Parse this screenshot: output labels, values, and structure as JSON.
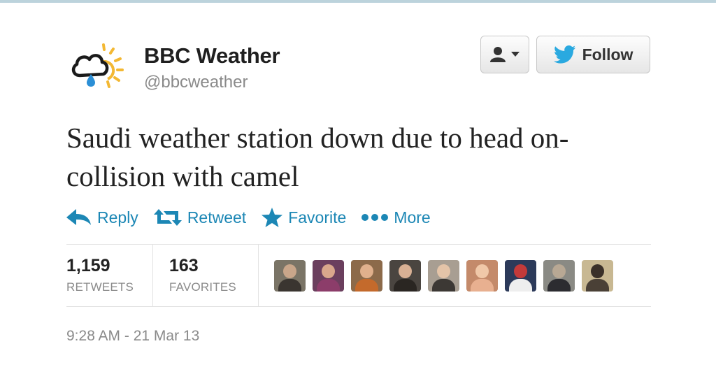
{
  "account": {
    "name": "BBC Weather",
    "handle": "@bbcweather"
  },
  "header": {
    "user_menu_icon": "person-dropdown-icon",
    "follow_label": "Follow",
    "follow_icon": "twitter-bird-icon"
  },
  "tweet": {
    "text": "Saudi weather station down due to head on-collision with camel",
    "timestamp": "9:28 AM - 21 Mar 13"
  },
  "actions": [
    {
      "label": "Reply",
      "icon": "reply-arrow-icon"
    },
    {
      "label": "Retweet",
      "icon": "retweet-icon"
    },
    {
      "label": "Favorite",
      "icon": "star-icon"
    },
    {
      "label": "More",
      "icon": "ellipsis-icon"
    }
  ],
  "stats": {
    "retweets_count": "1,159",
    "retweets_label": "RETWEETS",
    "favorites_count": "163",
    "favorites_label": "FAVORITES"
  },
  "colors": {
    "link": "#1c87b5",
    "sun": "#f3b833",
    "cloud": "#1a1a1a",
    "drop": "#2c8fd6"
  }
}
